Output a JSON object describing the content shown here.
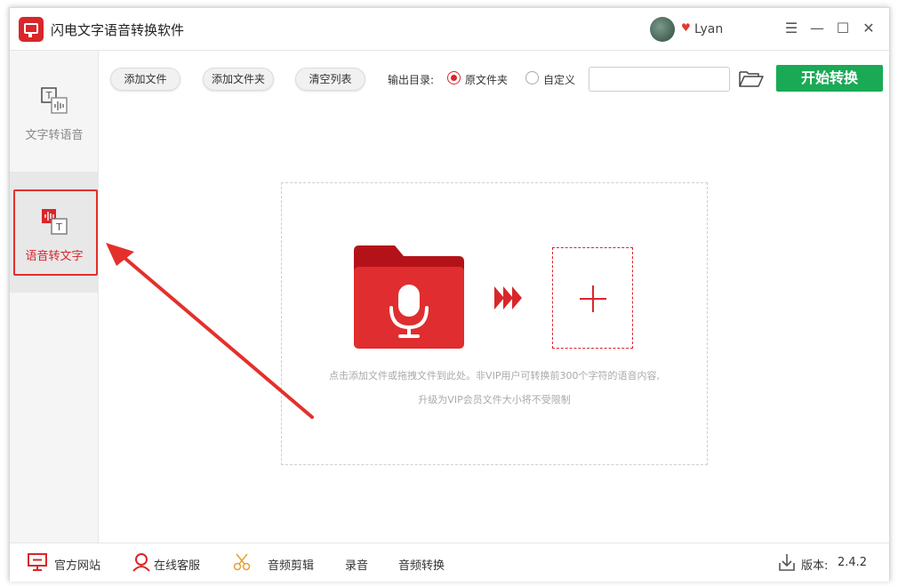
{
  "app": {
    "title": "闪电文字语音转换软件",
    "username": "Lyan"
  },
  "window_controls": {
    "menu": "☰",
    "minimize": "—",
    "maximize": "☐",
    "close": "✕"
  },
  "sidebar": {
    "items": [
      {
        "label": "文字转语音",
        "active": false
      },
      {
        "label": "语音转文字",
        "active": true
      }
    ]
  },
  "toolbar": {
    "add_file": "添加文件",
    "add_folder": "添加文件夹",
    "clear_list": "清空列表",
    "output_dir_label": "输出目录:",
    "option_original": "原文件夹",
    "option_custom": "自定义",
    "selected_option": "原文件夹",
    "path_value": "",
    "start": "开始转换"
  },
  "dropzone": {
    "hint_line1": "点击添加文件或拖拽文件到此处。非VIP用户可转换前300个字符的语音内容,",
    "hint_line2": "升级为VIP会员文件大小将不受限制"
  },
  "footer": {
    "official_site": "官方网站",
    "online_service": "在线客服",
    "audio_edit": "音频剪辑",
    "record": "录音",
    "audio_convert": "音频转换",
    "version_label": "版本:",
    "version": "2.4.2"
  },
  "colors": {
    "accent": "#d9262b",
    "start_button": "#1aaa55",
    "annotation_arrow": "#e4302b"
  },
  "icons": [
    "app-logo",
    "avatar",
    "vip-heart-icon",
    "text-to-speech-icon",
    "speech-to-text-icon",
    "folder-open-icon",
    "mic-folder-icon",
    "triple-arrow-icon",
    "plus-icon",
    "monitor-icon",
    "headset-user-icon",
    "scissors-icon",
    "download-icon"
  ]
}
